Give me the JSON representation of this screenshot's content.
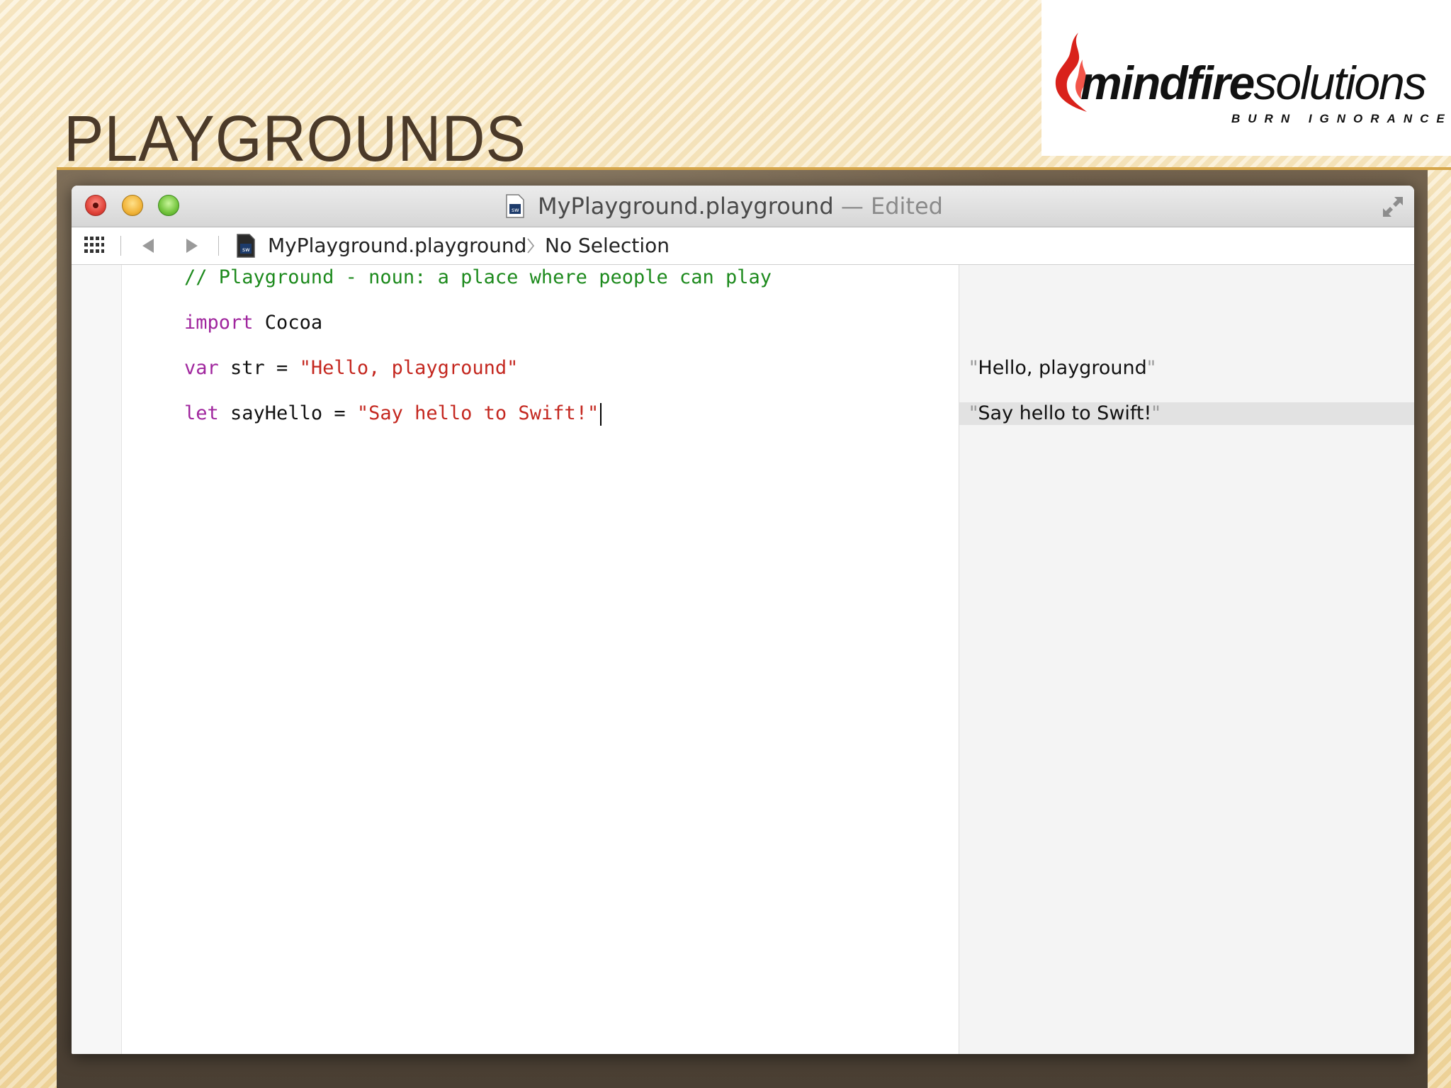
{
  "slide": {
    "title": "PLAYGROUNDS"
  },
  "logo": {
    "brand_strong": "mindfire",
    "brand_light": "solutions",
    "tagline": "BURN IGNORANCE",
    "flame_color": "#d9221b"
  },
  "window": {
    "title": "MyPlayground.playground",
    "title_separator": " — ",
    "edited_label": "Edited"
  },
  "jumpbar": {
    "file": "MyPlayground.playground",
    "selection": "No Selection"
  },
  "code": {
    "line1_comment": "// Playground - noun: a place where people can play",
    "line2_keyword": "import",
    "line2_rest": " Cocoa",
    "line3_keyword": "var",
    "line3_rest": " str = ",
    "line3_string": "\"Hello, playground\"",
    "line4_keyword": "let",
    "line4_rest": " sayHello = ",
    "line4_string": "\"Say hello to Swift!\""
  },
  "results": {
    "row1": "Hello, playground",
    "row2": "Say hello to Swift!"
  },
  "colors": {
    "comment": "#1d8a1d",
    "keyword": "#a0269e",
    "string": "#c4271f",
    "title_text": "#4b3a29"
  }
}
